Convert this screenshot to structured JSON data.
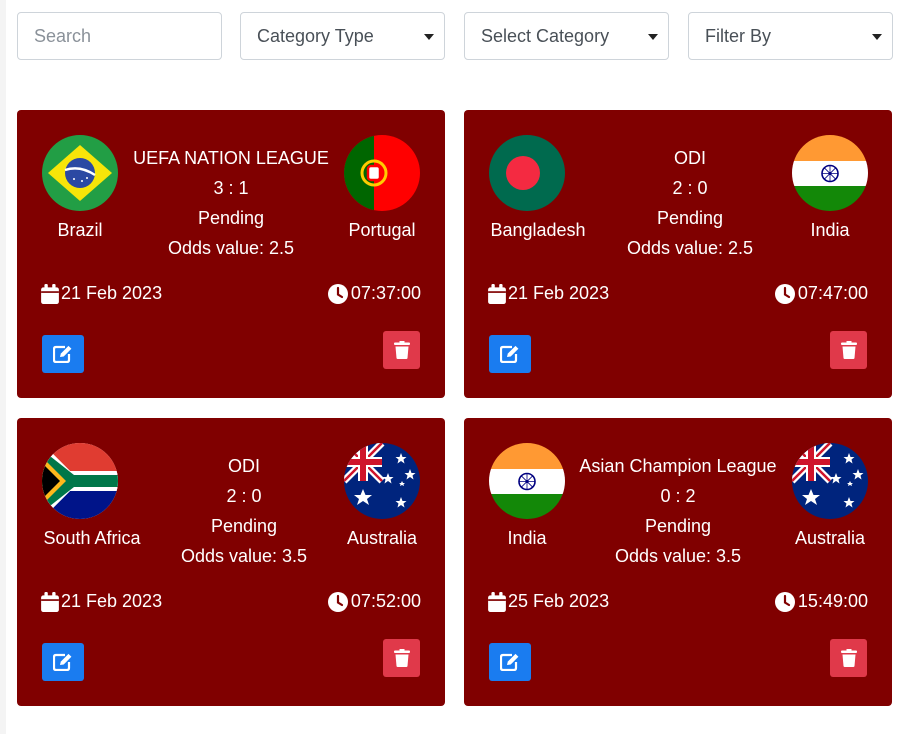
{
  "filters": {
    "search_placeholder": "Search",
    "category_type": "Category Type",
    "select_category": "Select Category",
    "filter_by": "Filter By"
  },
  "colors": {
    "card_bg": "#800000",
    "edit_btn": "#1a7cf0",
    "delete_btn": "#e0394a"
  },
  "icons": {
    "date": "calendar-icon",
    "time": "clock-icon",
    "edit": "edit-icon",
    "delete": "trash-icon"
  },
  "matches": [
    {
      "team1": "Brazil",
      "team2": "Portugal",
      "league": "UEFA NATION LEAGUE",
      "score": "3 : 1",
      "status": "Pending",
      "odds": "Odds value: 2.5",
      "date": "21 Feb 2023",
      "time": "07:37:00"
    },
    {
      "team1": "Bangladesh",
      "team2": "India",
      "league": "ODI",
      "score": "2 : 0",
      "status": "Pending",
      "odds": "Odds value: 2.5",
      "date": "21 Feb 2023",
      "time": "07:47:00"
    },
    {
      "team1": "South Africa",
      "team2": "Australia",
      "league": "ODI",
      "score": "2 : 0",
      "status": "Pending",
      "odds": "Odds value: 3.5",
      "date": "21 Feb 2023",
      "time": "07:52:00"
    },
    {
      "team1": "India",
      "team2": "Australia",
      "league": "Asian Champion League",
      "score": "0 : 2",
      "status": "Pending",
      "odds": "Odds value: 3.5",
      "date": "25 Feb 2023",
      "time": "15:49:00"
    }
  ]
}
